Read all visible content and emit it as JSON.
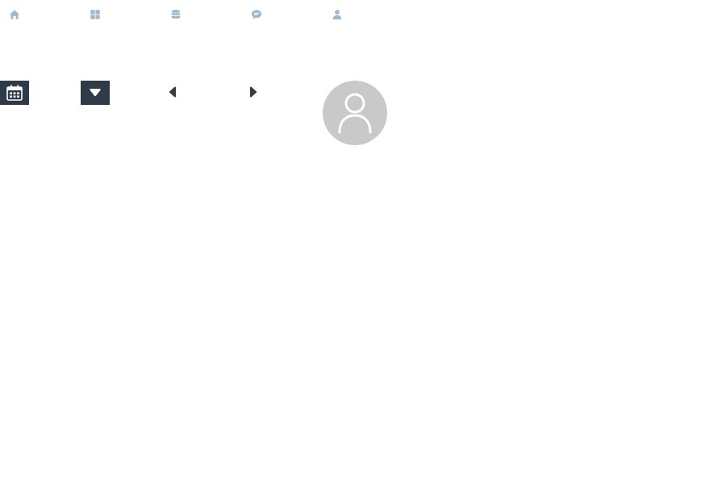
{
  "nav": {
    "items": [
      {
        "icon": "home-icon"
      },
      {
        "icon": "dashboard-icon"
      },
      {
        "icon": "database-icon"
      },
      {
        "icon": "chat-icon"
      },
      {
        "icon": "user-icon"
      }
    ],
    "icon_color": "#9fb8cc"
  },
  "toolbar": {
    "calendar_button": {
      "icon": "calendar-icon"
    },
    "dropdown_button": {
      "icon": "caret-down-icon"
    },
    "prev_button": {
      "icon": "caret-left-icon"
    },
    "next_button": {
      "icon": "caret-right-icon"
    },
    "button_bg_color": "#2f3a48",
    "arrow_color": "#3b3b3b"
  },
  "avatar": {
    "icon": "user-outline-icon",
    "bg_color": "#c9c9c9"
  }
}
